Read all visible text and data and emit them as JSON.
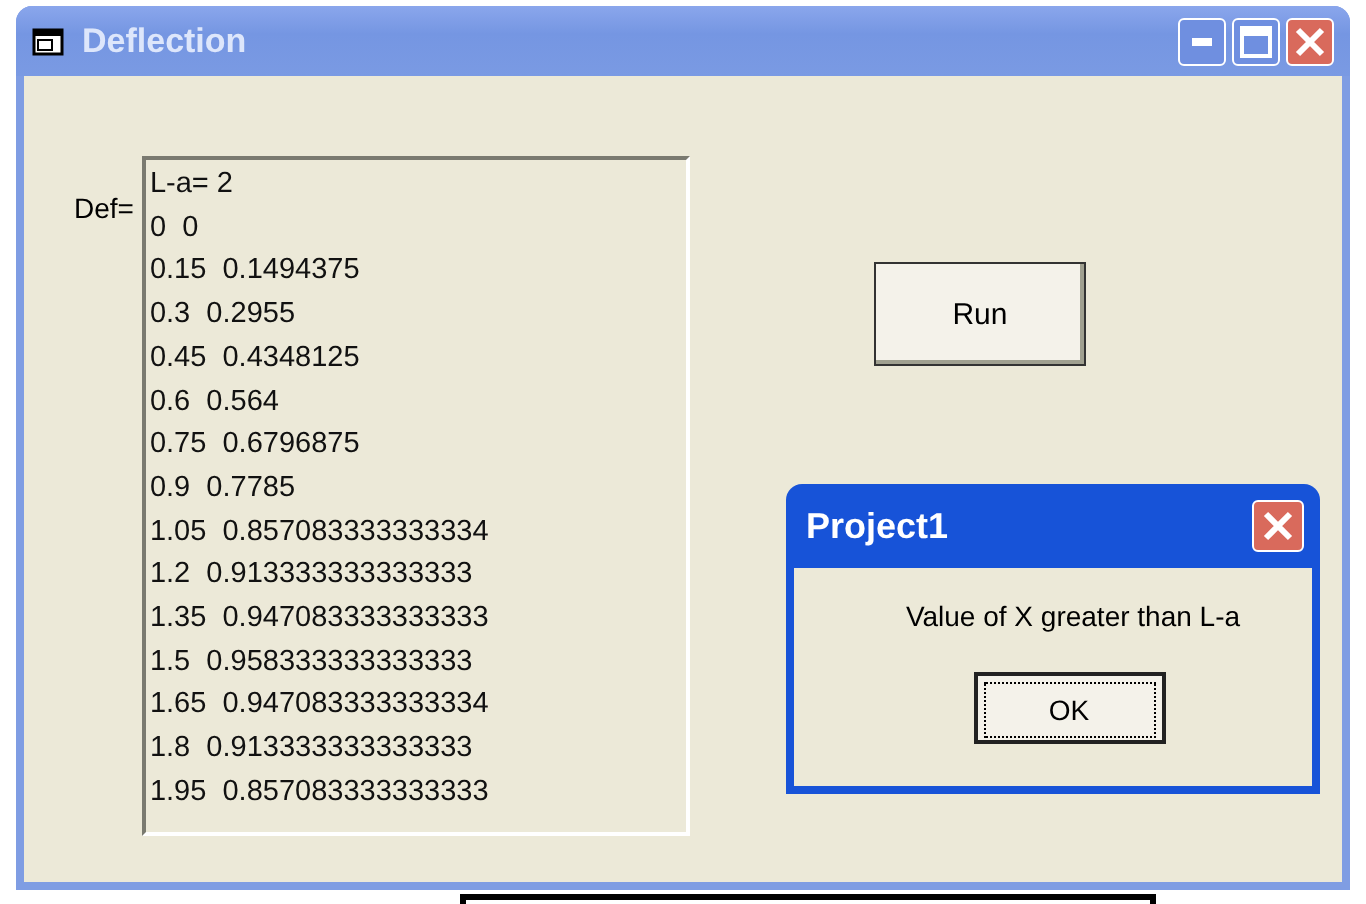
{
  "window": {
    "title": "Deflection"
  },
  "label": "Def=",
  "listbox": {
    "items": [
      "L-a= 2",
      "0  0",
      "0.15  0.1494375",
      "0.3  0.2955",
      "0.45  0.4348125",
      "0.6  0.564",
      "0.75  0.6796875",
      "0.9  0.7785",
      "1.05  0.857083333333334",
      "1.2  0.913333333333333",
      "1.35  0.947083333333333",
      "1.5  0.958333333333333",
      "1.65  0.947083333333334",
      "1.8  0.913333333333333",
      "1.95  0.857083333333333"
    ]
  },
  "run_button": "Run",
  "dialog": {
    "title": "Project1",
    "message": "Value of X greater than L-a",
    "button": "OK"
  }
}
